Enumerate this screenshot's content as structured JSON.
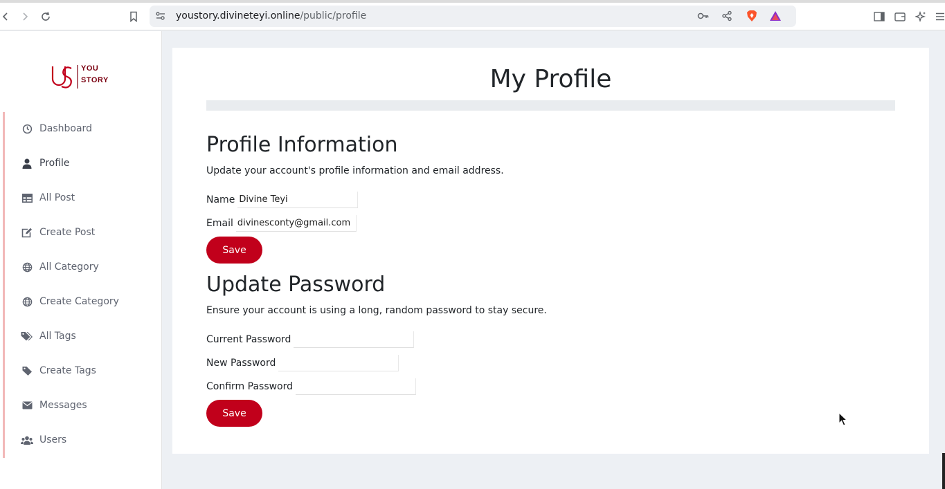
{
  "browser": {
    "url_domain": "youstory.divineteyi.online",
    "url_path": "/public/profile"
  },
  "brand": {
    "line1": "YOU",
    "line2": "STORY",
    "color": "#c1001b"
  },
  "sidebar": {
    "items": [
      {
        "label": "Dashboard",
        "icon": "clock-icon"
      },
      {
        "label": "Profile",
        "icon": "user-icon"
      },
      {
        "label": "All Post",
        "icon": "table-icon"
      },
      {
        "label": "Create Post",
        "icon": "edit-icon"
      },
      {
        "label": "All Category",
        "icon": "globe-icon"
      },
      {
        "label": "Create Category",
        "icon": "globe-icon"
      },
      {
        "label": "All Tags",
        "icon": "tags-icon"
      },
      {
        "label": "Create Tags",
        "icon": "tag-icon"
      },
      {
        "label": "Messages",
        "icon": "envelope-icon"
      },
      {
        "label": "Users",
        "icon": "users-icon"
      }
    ]
  },
  "main": {
    "page_title": "My Profile",
    "profile": {
      "heading": "Profile Information",
      "description": "Update your account's profile information and email address.",
      "name_label": "Name",
      "name_value": "Divine Teyi",
      "email_label": "Email",
      "email_value": "divinesconty@gmail.com",
      "save_label": "Save"
    },
    "password": {
      "heading": "Update Password",
      "description": "Ensure your account is using a long, random password to stay secure.",
      "current_label": "Current Password",
      "current_value": "",
      "new_label": "New Password",
      "new_value": "",
      "confirm_label": "Confirm Password",
      "confirm_value": "",
      "save_label": "Save"
    }
  },
  "colors": {
    "accent": "#c1001b",
    "background": "#edf0f4"
  }
}
